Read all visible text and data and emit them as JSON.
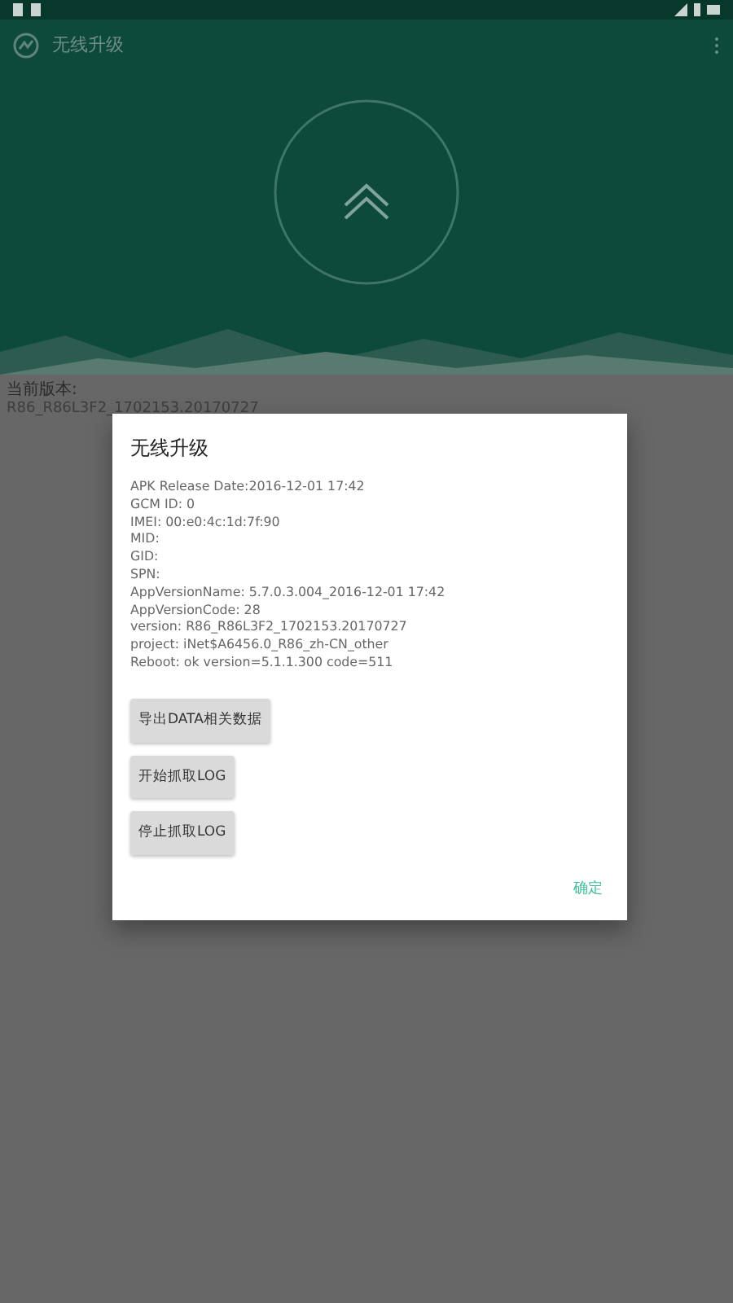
{
  "app_bar": {
    "title": "无线升级"
  },
  "current_version": {
    "label": "当前版本:",
    "value": "R86_R86L3F2_1702153.20170727"
  },
  "dialog": {
    "title": "无线升级",
    "info_lines": [
      "APK Release Date:2016-12-01 17:42",
      "GCM ID: 0",
      "IMEI: 00:e0:4c:1d:7f:90",
      "MID:",
      "GID:",
      "SPN:",
      "AppVersionName: 5.7.0.3.004_2016-12-01 17:42",
      "AppVersionCode: 28",
      "version: R86_R86L3F2_1702153.20170727",
      "project: iNet$A6456.0_R86_zh-CN_other",
      "Reboot: ok version=5.1.1.300 code=511"
    ],
    "buttons": [
      "导出DATA相关数据",
      "开始抓取LOG",
      "停止抓取LOG"
    ],
    "confirm": "确定"
  }
}
